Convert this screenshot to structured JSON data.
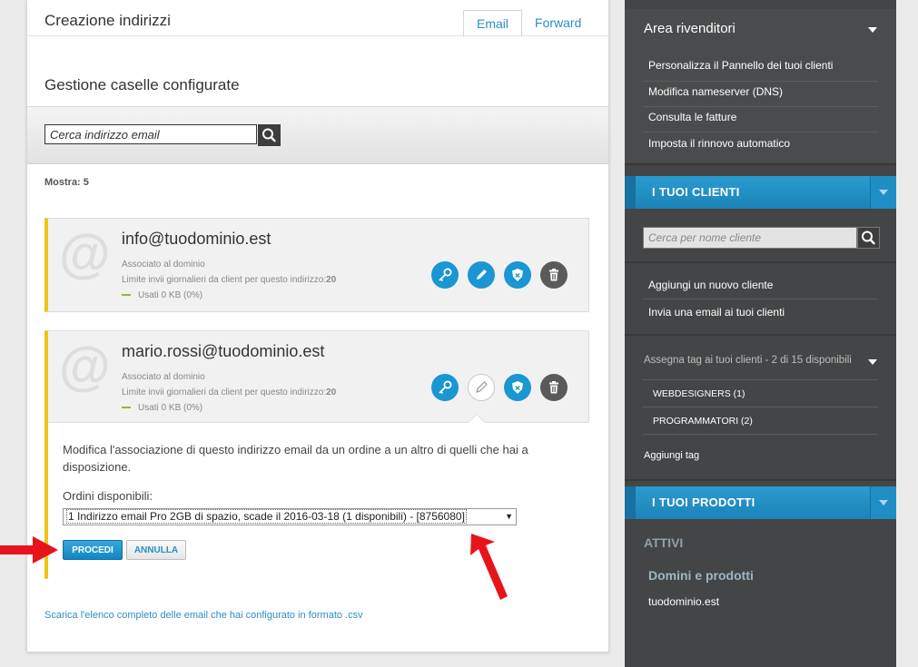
{
  "main": {
    "title": "Creazione indirizzi",
    "tabs": [
      {
        "label": "Email",
        "active": true
      },
      {
        "label": "Forward",
        "active": false
      }
    ],
    "subtitle": "Gestione caselle configurate",
    "search_placeholder": "Cerca indirizzo email",
    "mostra": "Mostra: 5",
    "cards": [
      {
        "email": "info@tuodominio.est",
        "associated": "Associato al dominio",
        "limit_label": "Limite invii giornalieri da client per questo indirizzo:",
        "limit_value": "20",
        "usage": "Usati 0 KB (0%)"
      },
      {
        "email": "mario.rossi@tuodominio.est",
        "associated": "Associato al dominio",
        "limit_label": "Limite invii giornalieri da client per questo indirizzo:",
        "limit_value": "20",
        "usage": "Usati 0 KB (0%)"
      }
    ],
    "edit_panel": {
      "description": "Modifica l'associazione di questo indirizzo email da un ordine a un altro di quelli che hai a disposizione.",
      "orders_label": "Ordini disponibili:",
      "selected_order": "1 Indirizzo email Pro 2GB di spazio, scade il 2016-03-18 (1 disponibili) - [8756080]",
      "proceed_label": "PROCEDI",
      "cancel_label": "ANNULLA"
    },
    "csv_link": "Scarica l'elenco completo delle email che hai configurato in formato .csv"
  },
  "sidebar": {
    "reseller_title": "Area rivenditori",
    "reseller_links": [
      "Personalizza il Pannello dei tuoi clienti",
      "Modifica nameserver (DNS)",
      "Consulta le fatture",
      "Imposta il rinnovo automatico"
    ],
    "clients_header": "I TUOI CLIENTI",
    "client_search_placeholder": "Cerca per nome cliente",
    "client_links": [
      "Aggiungi un nuovo cliente",
      "Invia una email ai tuoi clienti"
    ],
    "tags_title": "Assegna tag ai tuoi clienti - 2 di 15 disponibili",
    "tags": [
      "WEBDESIGNERS (1)",
      "PROGRAMMATORI (2)"
    ],
    "add_tag": "Aggiungi tag",
    "products_header": "I TUOI PRODOTTI",
    "active_label": "ATTIVI",
    "domains_title": "Domini e prodotti",
    "domain": "tuodominio.est"
  },
  "colors": {
    "accent": "#1a96d3",
    "card_border": "#f0c315",
    "sidebar_bg": "#444546",
    "arrow": "#e8141c"
  },
  "icons": [
    "search-icon",
    "at-icon",
    "key-icon",
    "pencil-icon",
    "shield-icon",
    "trash-icon",
    "chevron-down-icon",
    "red-arrow-icon"
  ]
}
